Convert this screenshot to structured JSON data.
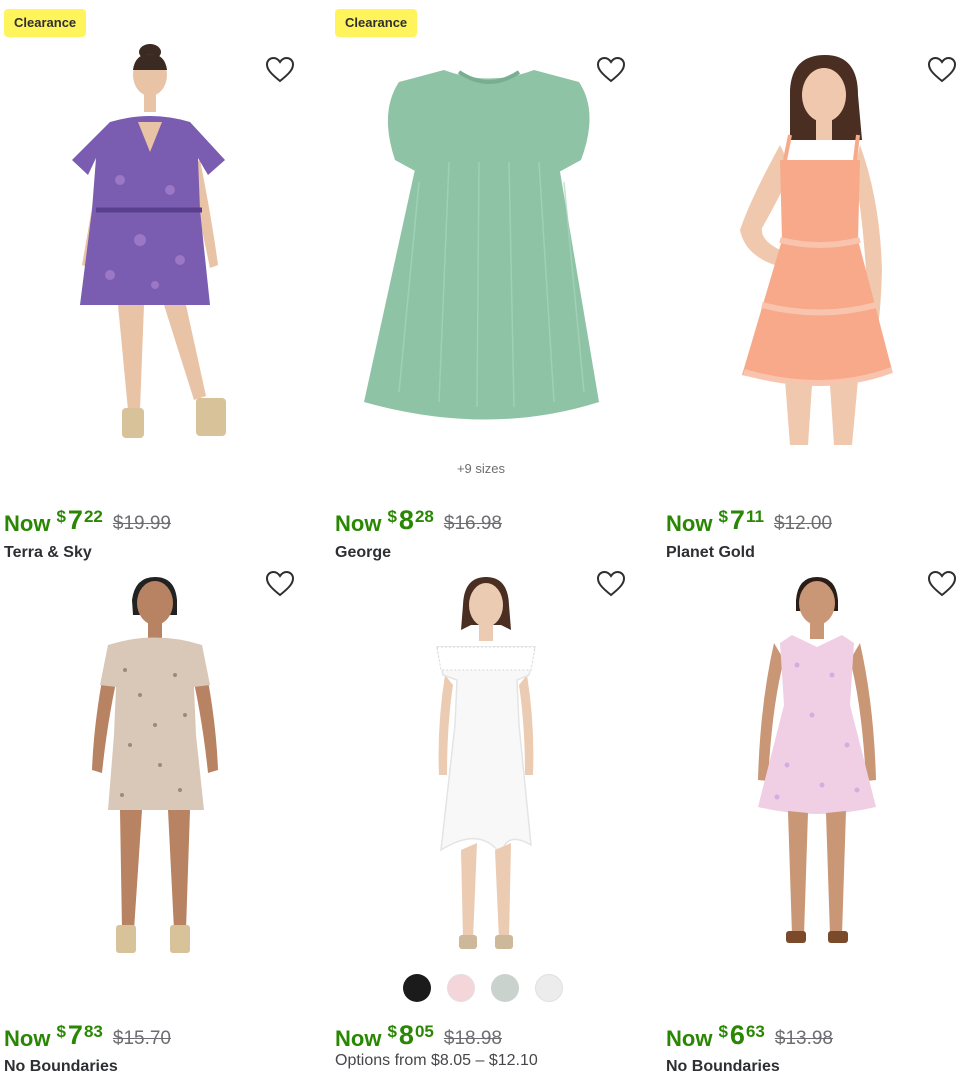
{
  "products": [
    {
      "badge": "Clearance",
      "now": "Now",
      "dollars": "7",
      "cents": "22",
      "was": "$19.99",
      "brand": "Terra & Sky",
      "dress_color": "#7a5cb0"
    },
    {
      "badge": "Clearance",
      "sizes": "+9 sizes",
      "now": "Now",
      "dollars": "8",
      "cents": "28",
      "was": "$16.98",
      "brand": "George",
      "dress_color": "#8ec3a6"
    },
    {
      "now": "Now",
      "dollars": "7",
      "cents": "11",
      "was": "$12.00",
      "brand": "Planet Gold",
      "dress_color": "#f7a98a"
    },
    {
      "now": "Now",
      "dollars": "7",
      "cents": "83",
      "was": "$15.70",
      "brand": "No Boundaries",
      "dress_color": "#d9c7b8"
    },
    {
      "now": "Now",
      "dollars": "8",
      "cents": "05",
      "was": "$18.98",
      "options": "Options from $8.05 – $12.10",
      "swatches": [
        "#1b1b1b",
        "#f3d5da",
        "#c9d2cd",
        "#ececec"
      ],
      "dress_color": "#f8f8f8"
    },
    {
      "now": "Now",
      "dollars": "6",
      "cents": "63",
      "was": "$13.98",
      "brand": "No Boundaries",
      "dress_color": "#f0cfe4"
    }
  ],
  "currency_symbol": "$",
  "colors": {
    "price_green": "#2a8703",
    "badge_yellow": "#fff45c",
    "text": "#2e2f32"
  }
}
